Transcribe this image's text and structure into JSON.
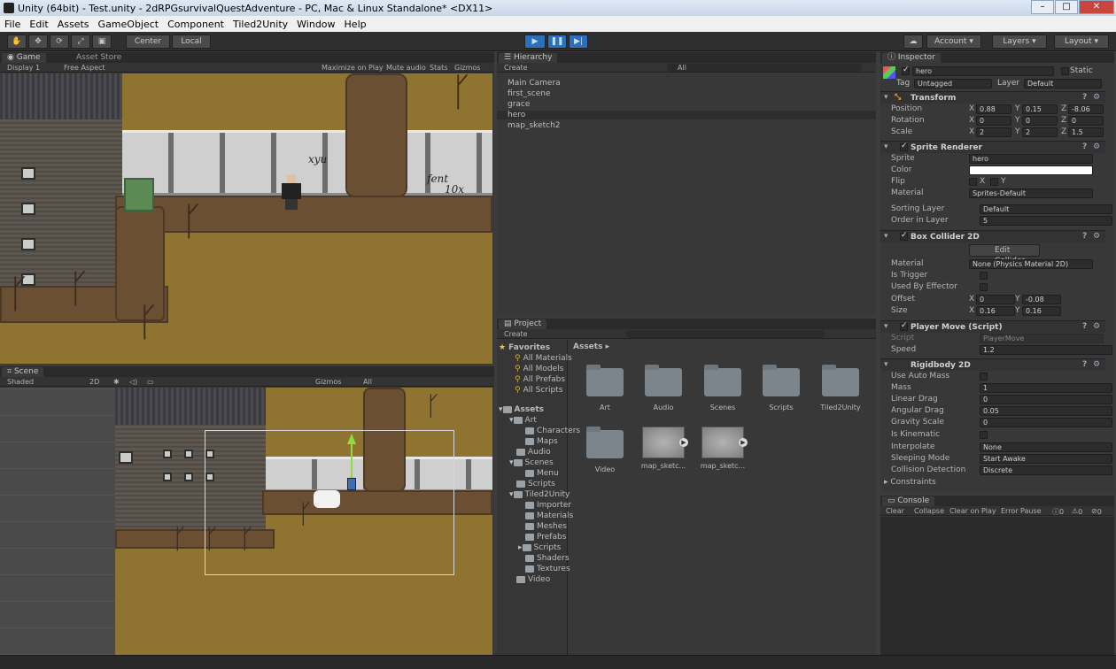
{
  "window": {
    "title": "Unity (64bit) - Test.unity - 2dRPGsurvivalQuestAdventure - PC, Mac & Linux Standalone* <DX11>"
  },
  "menu": [
    "File",
    "Edit",
    "Assets",
    "GameObject",
    "Component",
    "Tiled2Unity",
    "Window",
    "Help"
  ],
  "toolbar": {
    "center": "Center",
    "local": "Local",
    "account": "Account",
    "layers": "Layers",
    "layout": "Layout"
  },
  "game": {
    "tab": "Game",
    "store_tab": "Asset Store",
    "display": "Display 1",
    "aspect": "Free Aspect",
    "maximize": "Maximize on Play",
    "mute": "Mute audio",
    "stats": "Stats",
    "gizmos": "Gizmos",
    "graffiti1": "xyu",
    "graffiti2": "fent",
    "graffiti3": "10x"
  },
  "scene": {
    "tab": "Scene",
    "shaded": "Shaded",
    "mode2d": "2D",
    "gizmos": "Gizmos",
    "search": "All"
  },
  "hierarchy": {
    "tab": "Hierarchy",
    "create": "Create",
    "search": "All",
    "items": [
      "Main Camera",
      "first_scene",
      "grace",
      "hero",
      "map_sketch2"
    ]
  },
  "project": {
    "tab": "Project",
    "create": "Create",
    "favorites": "Favorites",
    "fav_items": [
      "All Materials",
      "All Models",
      "All Prefabs",
      "All Scripts"
    ],
    "assets_root": "Assets",
    "tree": [
      "Art",
      "Characters",
      "Maps",
      "Audio",
      "Scenes",
      "Menu",
      "Scripts",
      "Tiled2Unity",
      "Importer",
      "Materials",
      "Meshes",
      "Prefabs",
      "Scripts",
      "Shaders",
      "Textures",
      "Video"
    ],
    "breadcrumb": "Assets ▸",
    "grid": [
      "Art",
      "Audio",
      "Scenes",
      "Scripts",
      "Tiled2Unity",
      "Video",
      "map_sketc...",
      "map_sketc..."
    ]
  },
  "inspector": {
    "tab": "Inspector",
    "name": "hero",
    "static": "Static",
    "tag_label": "Tag",
    "tag": "Untagged",
    "layer_label": "Layer",
    "layer": "Default",
    "transform": {
      "title": "Transform",
      "position": "Position",
      "rotation": "Rotation",
      "scale": "Scale",
      "px": "0.88",
      "py": "0.15",
      "pz": "-8.06",
      "rx": "0",
      "ry": "0",
      "rz": "0",
      "sx": "2",
      "sy": "2",
      "sz": "1.5"
    },
    "sprite_renderer": {
      "title": "Sprite Renderer",
      "sprite_label": "Sprite",
      "sprite": "hero",
      "color_label": "Color",
      "flip_label": "Flip",
      "flip_x": "X",
      "flip_y": "Y",
      "material_label": "Material",
      "material": "Sprites-Default",
      "sorting_label": "Sorting Layer",
      "sorting": "Default",
      "order_label": "Order in Layer",
      "order": "5"
    },
    "box_collider": {
      "title": "Box Collider 2D",
      "edit": "Edit Collider",
      "material_label": "Material",
      "material": "None (Physics Material 2D)",
      "trigger": "Is Trigger",
      "effector": "Used By Effector",
      "offset_label": "Offset",
      "ox": "0",
      "oy": "-0.08",
      "size_label": "Size",
      "sx": "0.16",
      "sy": "0.16"
    },
    "player_move": {
      "title": "Player Move (Script)",
      "script_label": "Script",
      "script": "PlayerMove",
      "speed_label": "Speed",
      "speed": "1.2"
    },
    "rigidbody": {
      "title": "Rigidbody 2D",
      "auto_mass": "Use Auto Mass",
      "mass_label": "Mass",
      "mass": "1",
      "linear_label": "Linear Drag",
      "linear": "0",
      "angular_label": "Angular Drag",
      "angular": "0.05",
      "gravity_label": "Gravity Scale",
      "gravity": "0",
      "kinematic": "Is Kinematic",
      "interp_label": "Interpolate",
      "interp": "None",
      "sleep_label": "Sleeping Mode",
      "sleep": "Start Awake",
      "collision_label": "Collision Detection",
      "collision": "Discrete",
      "constraints": "Constraints"
    }
  },
  "console": {
    "tab": "Console",
    "clear": "Clear",
    "collapse": "Collapse",
    "clear_on_play": "Clear on Play",
    "error_pause": "Error Pause",
    "c1": "0",
    "c2": "0",
    "c3": "0"
  },
  "colors": {
    "editor_bg": "#383838",
    "play_blue": "#2d6fb8",
    "ground": "#8f7330"
  }
}
